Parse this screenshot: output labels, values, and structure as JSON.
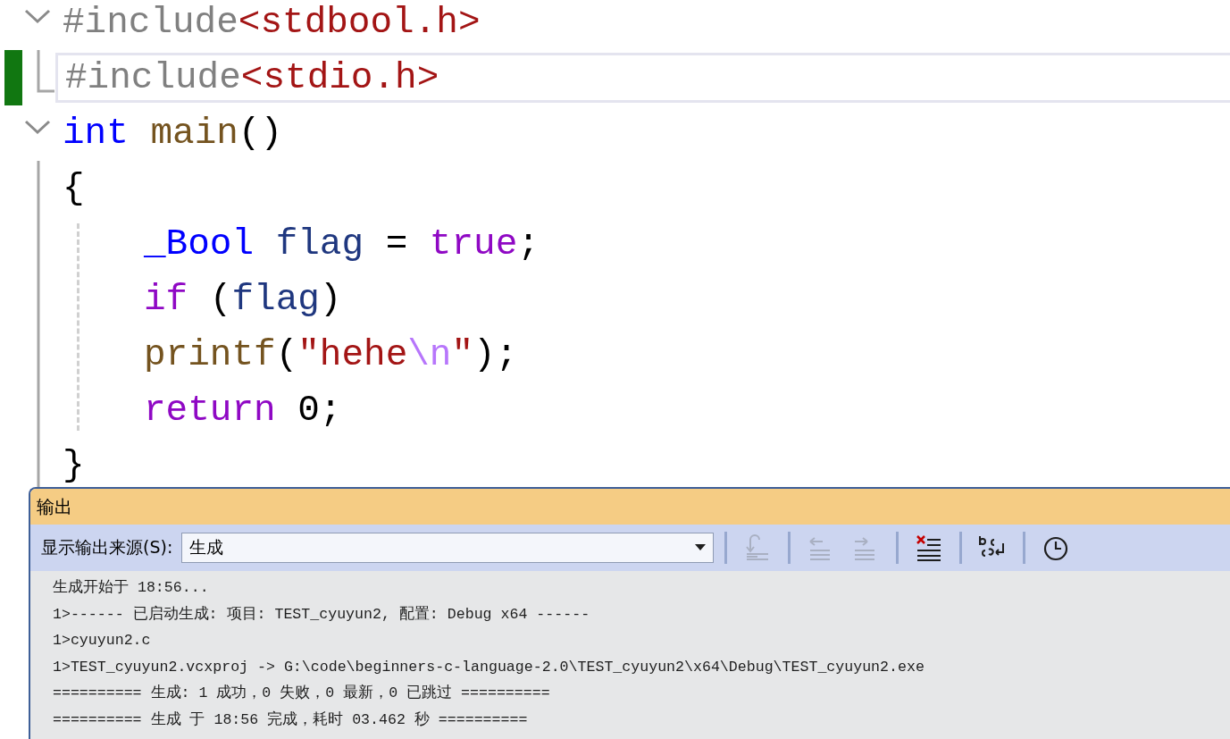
{
  "editor": {
    "lines": [
      {
        "kind": "collapse",
        "changed": false,
        "current": false,
        "tokens": [
          {
            "kind": "preproc",
            "text": "#include"
          },
          {
            "kind": "header",
            "text": "<stdbool.h>"
          }
        ]
      },
      {
        "kind": "end",
        "changed": true,
        "current": true,
        "tokens": [
          {
            "kind": "preproc",
            "text": "#include"
          },
          {
            "kind": "header",
            "text": "<stdio.h>"
          }
        ]
      },
      {
        "kind": "collapse",
        "changed": false,
        "current": false,
        "tokens": [
          {
            "kind": "type",
            "text": "int "
          },
          {
            "kind": "function",
            "text": "main"
          },
          {
            "kind": "plain",
            "text": "()"
          }
        ]
      },
      {
        "kind": "line",
        "changed": false,
        "current": false,
        "tokens": [
          {
            "kind": "plain",
            "text": "{"
          }
        ],
        "children": [
          {
            "kind": "line",
            "changed": false,
            "current": false,
            "tokens": [
              {
                "kind": "type",
                "text": "_Bool "
              },
              {
                "kind": "variable",
                "text": "flag"
              },
              {
                "kind": "plain",
                "text": " = "
              },
              {
                "kind": "control",
                "text": "true"
              },
              {
                "kind": "plain",
                "text": ";"
              }
            ]
          },
          {
            "kind": "line",
            "changed": false,
            "current": false,
            "tokens": [
              {
                "kind": "control",
                "text": "if"
              },
              {
                "kind": "plain",
                "text": " ("
              },
              {
                "kind": "variable",
                "text": "flag"
              },
              {
                "kind": "plain",
                "text": ")"
              }
            ]
          },
          {
            "kind": "line",
            "changed": false,
            "current": false,
            "tokens": [
              {
                "kind": "function",
                "text": "printf"
              },
              {
                "kind": "plain",
                "text": "("
              },
              {
                "kind": "string",
                "text": "\"hehe"
              },
              {
                "kind": "escape",
                "text": "\\n"
              },
              {
                "kind": "string",
                "text": "\""
              },
              {
                "kind": "plain",
                "text": ");"
              }
            ]
          },
          {
            "kind": "line",
            "changed": false,
            "current": false,
            "tokens": [
              {
                "kind": "control",
                "text": "return"
              },
              {
                "kind": "plain",
                "text": " 0;"
              }
            ]
          }
        ]
      },
      {
        "kind": "line",
        "changed": false,
        "current": false,
        "tokens": [
          {
            "kind": "plain",
            "text": "}"
          }
        ]
      }
    ]
  },
  "output": {
    "title": "输出",
    "source_label": "显示输出来源(S):",
    "source_value": "生成",
    "toolbar_buttons": [
      {
        "kind": "goto",
        "disabled": true
      },
      {
        "kind": "prev",
        "disabled": true
      },
      {
        "kind": "next",
        "disabled": true
      },
      {
        "kind": "clear",
        "disabled": false
      },
      {
        "kind": "wrap",
        "disabled": false
      },
      {
        "kind": "clock",
        "disabled": false
      }
    ],
    "lines": [
      "生成开始于 18:56...",
      "1>------ 已启动生成: 项目: TEST_cyuyun2, 配置: Debug x64 ------",
      "1>cyuyun2.c",
      "1>TEST_cyuyun2.vcxproj -> G:\\code\\beginners-c-language-2.0\\TEST_cyuyun2\\x64\\Debug\\TEST_cyuyun2.exe",
      "========== 生成: 1 成功，0 失败，0 最新，0 已跳过 ==========",
      "========== 生成 于 18:56 完成，耗时 03.462 秒 =========="
    ]
  }
}
